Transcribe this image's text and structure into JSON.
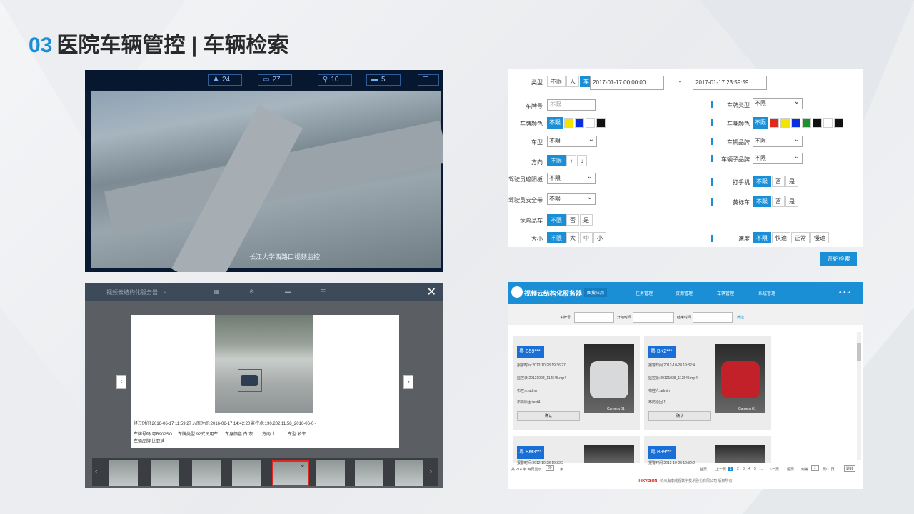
{
  "slide": {
    "number": "03",
    "title": "医院车辆管控 | 车辆检索"
  },
  "monitor": {
    "stats": [
      {
        "icon": "person-icon",
        "value": "24"
      },
      {
        "icon": "car-icon",
        "value": "27"
      },
      {
        "icon": "bike-icon",
        "value": "10"
      },
      {
        "icon": "truck-icon",
        "value": "5"
      }
    ],
    "caption": "长江大学西路口视频监控"
  },
  "search_form": {
    "type_label": "类型",
    "type_options": [
      "不限",
      "人",
      "车"
    ],
    "type_selected": "车",
    "start_time": "2017-01-17 00:00:00",
    "dash": "-",
    "end_time": "2017-01-17 23:59:59",
    "plate_no_label": "车牌号",
    "plate_no_placeholder": "不限",
    "plate_type_label": "车牌类型",
    "plate_type_value": "不限",
    "plate_color_label": "车牌颜色",
    "plate_color_option": "不限",
    "body_color_label": "车身颜色",
    "body_color_option": "不限",
    "vehicle_type_label": "车型",
    "vehicle_type_value": "不限",
    "brand_label": "车辆品牌",
    "brand_value": "不限",
    "direction_label": "方向",
    "direction_options": [
      "不限",
      "↑",
      "↓"
    ],
    "sub_brand_label": "车辆子品牌",
    "sub_brand_value": "不限",
    "sunshade_label": "驾驶员遮阳板",
    "sunshade_value": "不限",
    "phone_label": "打手机",
    "phone_options": [
      "不限",
      "否",
      "是"
    ],
    "seatbelt_label": "驾驶员安全带",
    "seatbelt_value": "不限",
    "yellow_label": "黄标车",
    "yellow_options": [
      "不限",
      "否",
      "是"
    ],
    "danger_label": "危险品车",
    "danger_options": [
      "不限",
      "否",
      "是"
    ],
    "size_label": "大小",
    "size_options": [
      "不限",
      "大",
      "中",
      "小"
    ],
    "speed_label": "速度",
    "speed_options": [
      "不限",
      "快速",
      "正常",
      "慢速"
    ],
    "search_button": "开始检索",
    "plate_colors": [
      "#f2e600",
      "#0a2fe0",
      "#ffffff",
      "#111111"
    ],
    "body_colors": [
      "#e0281e",
      "#f2e600",
      "#0a2fe0",
      "#1d8f2e",
      "#111111",
      "#ffffff",
      "#111111"
    ]
  },
  "detail": {
    "app_title": "视频云结构化服务器",
    "close": "✕",
    "lines": [
      "经过时间:2016-06-17 11:59:27",
      "入库时间:2016-06-17 14:42:20",
      "监控点:190.202.11.58_2016-06-0~",
      "车牌号码:粤B902SG",
      "车牌类型:92式民用车",
      "车身颜色:白/灰",
      "方向:上",
      "车型:轿车",
      "车辆品牌:比亚迪"
    ]
  },
  "results": {
    "app_title": "视频云结构化服务器",
    "menu": [
      "图搜应用",
      "任务管理",
      "资源管理",
      "车辆管理",
      "系统管理"
    ],
    "search_labels": [
      "车牌号",
      "开始时间",
      "结束时间"
    ],
    "filter_label": "筛选",
    "cards": [
      {
        "plate": "粤 B59***",
        "time": "报警时间:2012-10-28 19:36:27",
        "source": "监控录:20121028_112545.mp4",
        "owner": "布控人:admin",
        "reason": "布防原因:test4",
        "button": "确认",
        "cam": "Camera 01"
      },
      {
        "plate": "粤 BK2***",
        "time": "报警时间:2012-10-28 19:32:4",
        "source": "监控录:20121028_112545.mp4",
        "owner": "布控人:admin",
        "reason": "布防原因:1",
        "button": "确认",
        "cam": "Camera 01"
      },
      {
        "plate": "粤 BM3***",
        "time": "报警时间:2012-10-28 19:32:2",
        "source": "",
        "owner": "",
        "reason": "",
        "button": "",
        "cam": ""
      },
      {
        "plate": "粤 B99***",
        "time": "报警时间:2012-10-28 19:32:2",
        "source": "",
        "owner": "",
        "reason": "",
        "button": "",
        "cam": ""
      }
    ],
    "pager_left": "共 214 条  每页显示",
    "page_size": "20",
    "pager_unit": "条",
    "first": "首页",
    "prev": "上一页",
    "pages": [
      "1",
      "2",
      "3",
      "4",
      "5",
      "..."
    ],
    "next": "下一页",
    "last": "尾页",
    "goto": "到第",
    "goto_page": "1",
    "total_pages": "页/11页",
    "go": "跳转",
    "footer_brand": "HIKVISION",
    "footer": "杭州海康威视数字技术股份有限公司  版权所有"
  }
}
